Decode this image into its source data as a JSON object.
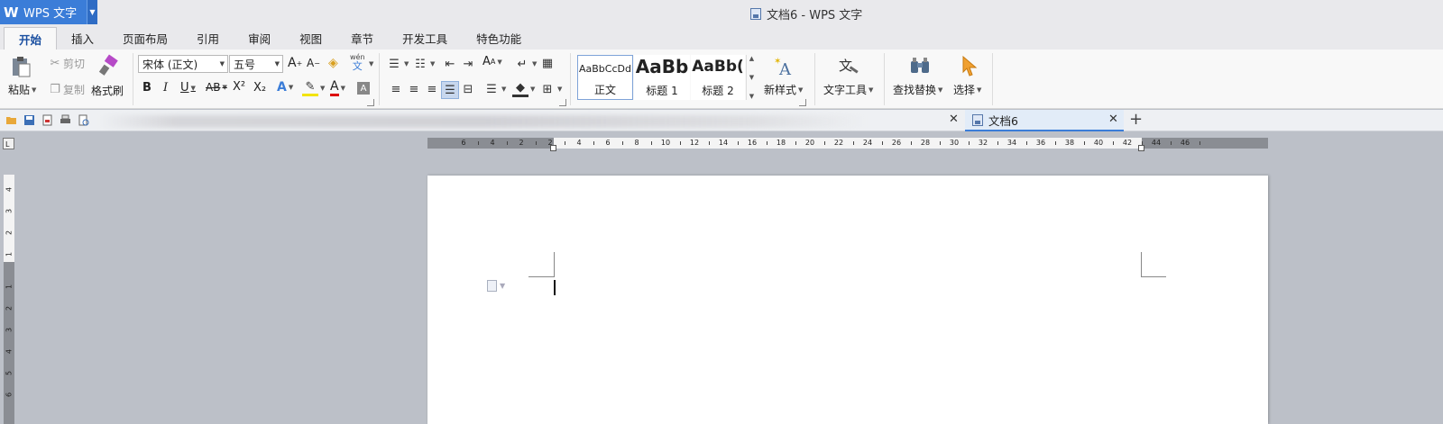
{
  "app": {
    "name": "WPS 文字",
    "logo": "W"
  },
  "window": {
    "title": "文档6 - WPS 文字"
  },
  "menu_tabs": [
    {
      "label": "开始",
      "active": true
    },
    {
      "label": "插入"
    },
    {
      "label": "页面布局"
    },
    {
      "label": "引用"
    },
    {
      "label": "审阅"
    },
    {
      "label": "视图"
    },
    {
      "label": "章节"
    },
    {
      "label": "开发工具"
    },
    {
      "label": "特色功能"
    }
  ],
  "ribbon": {
    "paste": "粘贴",
    "cut": "剪切",
    "copy": "复制",
    "format_painter": "格式刷",
    "font_name": "宋体 (正文)",
    "font_size": "五号",
    "phonetic": "wén",
    "phonetic_char": "文",
    "styles": [
      {
        "preview": "AaBbCcDd",
        "label": "正文"
      },
      {
        "preview": "AaBb",
        "label": "标题 1"
      },
      {
        "preview": "AaBb(",
        "label": "标题 2"
      }
    ],
    "new_style": "新样式",
    "text_tools": "文字工具",
    "find_replace": "查找替换",
    "select": "选择",
    "bold": "B",
    "italic": "I",
    "underline": "U",
    "strike": "AB",
    "superscript": "X²",
    "subscript": "X₂",
    "font_color_a": "A"
  },
  "doc_tabs": [
    {
      "label": "文档6",
      "active": true
    }
  ],
  "ruler": {
    "labels": [
      "6",
      "4",
      "2",
      "2",
      "4",
      "6",
      "8",
      "10",
      "12",
      "14",
      "16",
      "18",
      "20",
      "22",
      "24",
      "26",
      "28",
      "30",
      "32",
      "34",
      "36",
      "38",
      "40",
      "42",
      "44",
      "46"
    ],
    "vertical_labels": [
      "4",
      "3",
      "2",
      "1",
      "1",
      "2",
      "3",
      "4",
      "5",
      "6"
    ]
  },
  "colors": {
    "accent": "#3b7dd8",
    "workspace": "#bcc0c8"
  }
}
